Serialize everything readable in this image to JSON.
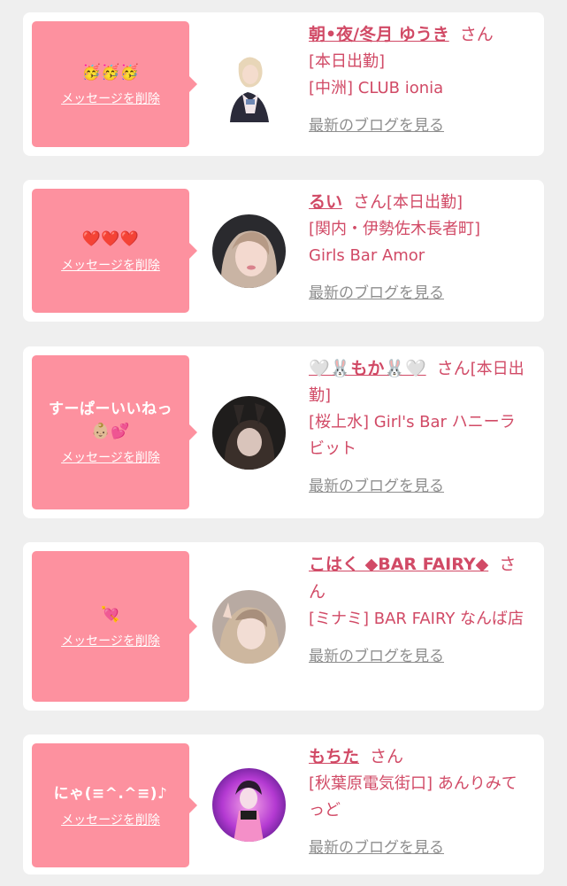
{
  "colors": {
    "page_bg": "#efefef",
    "card_bg": "#ffffff",
    "bubble_bg": "#fd919f",
    "accent_text": "#d14a66",
    "link_gray": "#8e8e8e"
  },
  "items": [
    {
      "message": "🥳🥳🥳",
      "delete_label": "メッセージを削除",
      "cast_name": "朝•夜/冬月 ゆうき",
      "honorific": "さん",
      "status": "[本日出勤]",
      "shop": "[中洲] CLUB ionia",
      "blog_link": "最新のブログを見る",
      "avatar_icon": "avatar-photo"
    },
    {
      "message": "❤️❤️❤️",
      "delete_label": "メッセージを削除",
      "cast_name": "るい",
      "honorific": "さん",
      "status": "[本日出勤]",
      "shop": "[関内・伊勢佐木長者町] Girls Bar Amor",
      "blog_link": "最新のブログを見る",
      "avatar_icon": "avatar-photo"
    },
    {
      "message": "すーぱーいいねっ👶🏼💕",
      "delete_label": "メッセージを削除",
      "cast_name": "🤍🐰もか🐰🤍",
      "honorific": "さん",
      "status": "[本日出勤]",
      "shop": "[桜上水] Girl's Bar ハニーラビット",
      "blog_link": "最新のブログを見る",
      "avatar_icon": "avatar-photo"
    },
    {
      "message": "💘",
      "delete_label": "メッセージを削除",
      "cast_name": "こはく ◆BAR FAIRY◆",
      "honorific": "さん",
      "status": "",
      "shop": "[ミナミ] BAR FAIRY なんば店",
      "blog_link": "最新のブログを見る",
      "avatar_icon": "avatar-photo"
    },
    {
      "message": "にゃ(≡^.^≡)♪",
      "delete_label": "メッセージを削除",
      "cast_name": "もちた",
      "honorific": "さん",
      "status": "",
      "shop": "[秋葉原電気街口] あんりみてっど",
      "blog_link": "最新のブログを見る",
      "avatar_icon": "avatar-photo"
    }
  ]
}
